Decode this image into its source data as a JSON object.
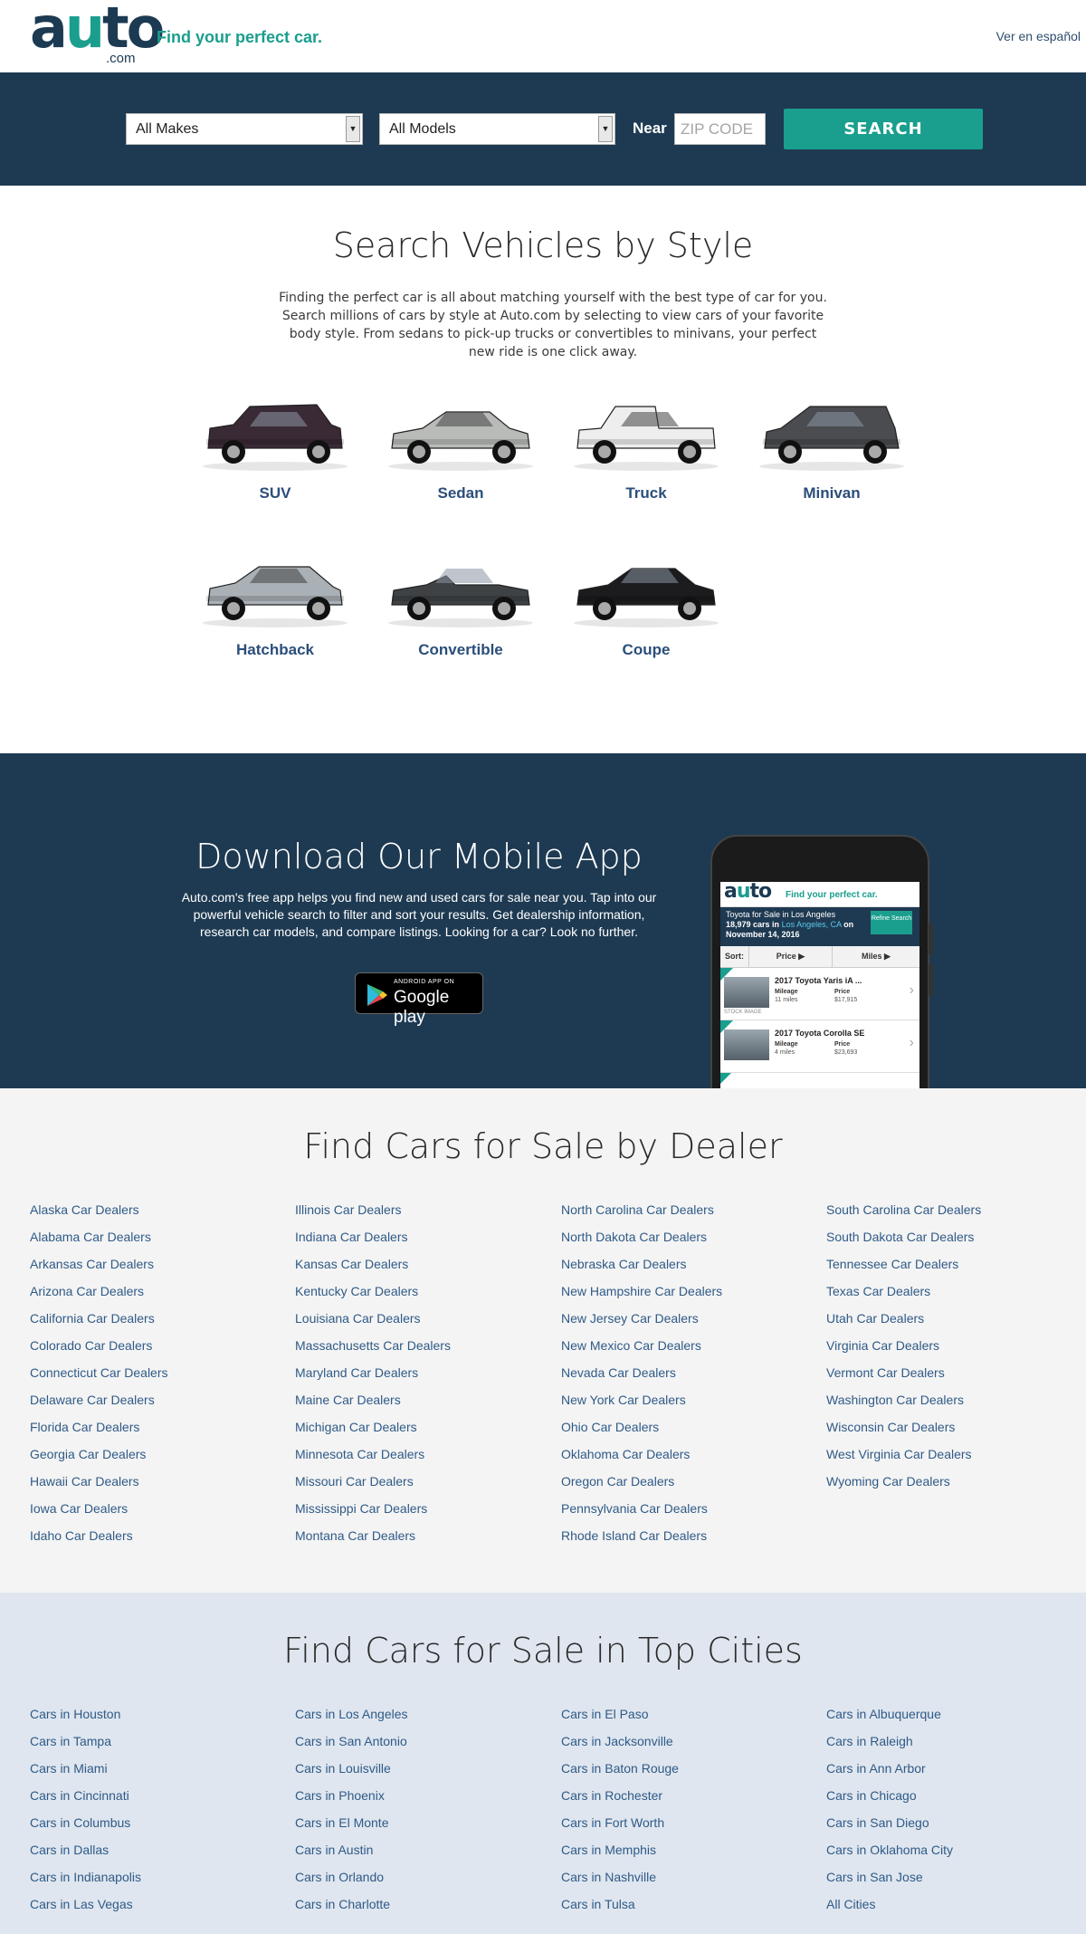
{
  "header": {
    "logo_main_a": "a",
    "logo_main_u": "u",
    "logo_main_to": "to",
    "logo_dotcom": ".com",
    "tagline": "Find your perfect car.",
    "lang_link": "Ver en español"
  },
  "search": {
    "makes_value": "All Makes",
    "models_value": "All Models",
    "near_label": "Near",
    "zip_placeholder": "ZIP CODE",
    "button_label": "SEARCH"
  },
  "styles": {
    "title": "Search Vehicles by Style",
    "description": "Finding the perfect car is all about matching yourself with the best type of car for you. Search millions of cars by style at Auto.com by selecting to view cars of your favorite body style.  From sedans to pick-up trucks or convertibles to minivans, your perfect new ride is one click away.",
    "items": [
      {
        "label": "SUV",
        "color": "#3a2a36"
      },
      {
        "label": "Sedan",
        "color": "#b9bbb8"
      },
      {
        "label": "Truck",
        "color": "#eeeeee"
      },
      {
        "label": "Minivan",
        "color": "#4a4c50"
      },
      {
        "label": "Hatchback",
        "color": "#a9b0b6"
      },
      {
        "label": "Convertible",
        "color": "#3f4245"
      },
      {
        "label": "Coupe",
        "color": "#1c1c1e"
      }
    ]
  },
  "app": {
    "title": "Download Our Mobile App",
    "description": "Auto.com's free app helps you find new and used cars for sale near you. Tap into our powerful vehicle search to filter and sort your results. Get dealership information, research car models, and compare listings. Looking for a car? Look no further.",
    "store_small": "ANDROID APP ON",
    "store_big": "Google play",
    "screen": {
      "logo_a": "a",
      "logo_u": "u",
      "logo_to": "to",
      "tagline": "Find your perfect car.",
      "band_line1": "Toyota for Sale in Los Angeles",
      "band_count": "18,979 cars in",
      "band_loc": "Los Angeles, CA",
      "band_on": "on",
      "band_date": "November 14, 2016",
      "refine_label": "Refine Search",
      "sort_label": "Sort:",
      "sort_price": "Price ▶",
      "sort_miles": "Miles ▶",
      "listings": [
        {
          "title": "2017 Toyota Yaris iA ...",
          "mileage_label": "Mileage",
          "mileage": "11 miles",
          "price_label": "Price",
          "price": "$17,915",
          "stock": "STOCK IMAGE"
        },
        {
          "title": "2017 Toyota Corolla SE",
          "mileage_label": "Mileage",
          "mileage": "4 miles",
          "price_label": "Price",
          "price": "$23,693",
          "stock": ""
        }
      ]
    }
  },
  "dealers": {
    "title": "Find Cars for Sale by Dealer",
    "columns": [
      [
        "Alaska Car Dealers",
        "Alabama Car Dealers",
        "Arkansas Car Dealers",
        "Arizona Car Dealers",
        "California Car Dealers",
        "Colorado Car Dealers",
        "Connecticut Car Dealers",
        "Delaware Car Dealers",
        "Florida Car Dealers",
        "Georgia Car Dealers",
        "Hawaii Car Dealers",
        "Iowa Car Dealers",
        "Idaho Car Dealers"
      ],
      [
        "Illinois Car Dealers",
        "Indiana Car Dealers",
        "Kansas Car Dealers",
        "Kentucky Car Dealers",
        "Louisiana Car Dealers",
        "Massachusetts Car Dealers",
        "Maryland Car Dealers",
        "Maine Car Dealers",
        "Michigan Car Dealers",
        "Minnesota Car Dealers",
        "Missouri Car Dealers",
        "Mississippi Car Dealers",
        "Montana Car Dealers"
      ],
      [
        "North Carolina Car Dealers",
        "North Dakota Car Dealers",
        "Nebraska Car Dealers",
        "New Hampshire Car Dealers",
        "New Jersey Car Dealers",
        "New Mexico Car Dealers",
        "Nevada Car Dealers",
        "New York Car Dealers",
        "Ohio Car Dealers",
        "Oklahoma Car Dealers",
        "Oregon Car Dealers",
        "Pennsylvania Car Dealers",
        "Rhode Island Car Dealers"
      ],
      [
        "South Carolina Car Dealers",
        "South Dakota Car Dealers",
        "Tennessee Car Dealers",
        "Texas Car Dealers",
        "Utah Car Dealers",
        "Virginia Car Dealers",
        "Vermont Car Dealers",
        "Washington Car Dealers",
        "Wisconsin Car Dealers",
        "West Virginia Car Dealers",
        "Wyoming Car Dealers"
      ]
    ]
  },
  "cities": {
    "title": "Find Cars for Sale in Top Cities",
    "columns": [
      [
        "Cars in Houston",
        "Cars in Tampa",
        "Cars in Miami",
        "Cars in Cincinnati",
        "Cars in Columbus",
        "Cars in Dallas",
        "Cars in Indianapolis",
        "Cars in Las Vegas"
      ],
      [
        "Cars in Los Angeles",
        "Cars in San Antonio",
        "Cars in Louisville",
        "Cars in Phoenix",
        "Cars in El Monte",
        "Cars in Austin",
        "Cars in Orlando",
        "Cars in Charlotte"
      ],
      [
        "Cars in El Paso",
        "Cars in Jacksonville",
        "Cars in Baton Rouge",
        "Cars in Rochester",
        "Cars in Fort Worth",
        "Cars in Memphis",
        "Cars in Nashville",
        "Cars in Tulsa"
      ],
      [
        "Cars in Albuquerque",
        "Cars in Raleigh",
        "Cars in Ann Arbor",
        "Cars in Chicago",
        "Cars in San Diego",
        "Cars in Oklahoma City",
        "Cars in San Jose",
        "All Cities"
      ]
    ]
  },
  "colors": {
    "navy": "#1e3a52",
    "teal": "#1a9e8e",
    "link": "#2f5a87"
  }
}
